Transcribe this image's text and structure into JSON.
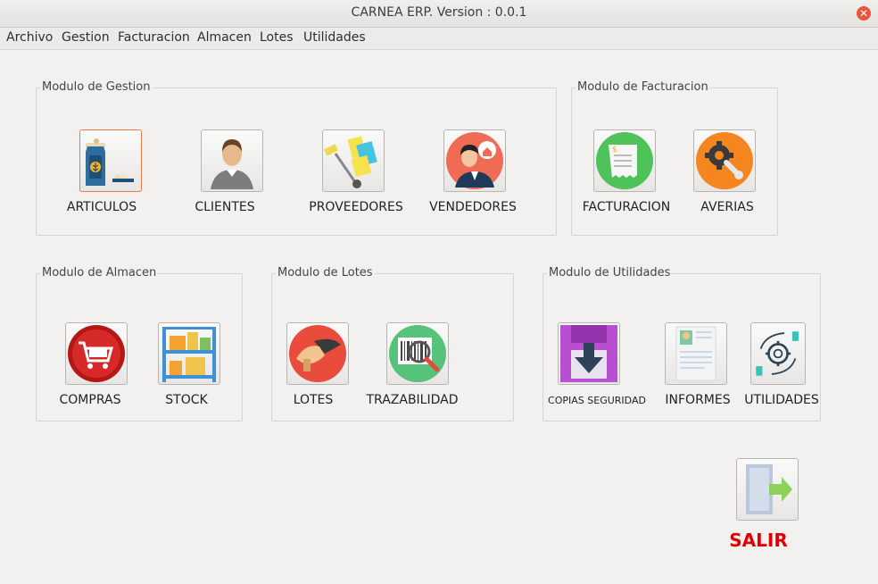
{
  "window": {
    "title": "CARNEA ERP. Version : 0.0.1"
  },
  "menu": [
    "Archivo",
    "Gestion",
    "Facturacion",
    "Almacen",
    "Lotes",
    "Utilidades"
  ],
  "groups": {
    "gestion": "Modulo de Gestion",
    "facturacion": "Modulo de Facturacion",
    "almacen": "Modulo de Almacen",
    "lotes": "Modulo de Lotes",
    "utilidades": "Modulo de Utilidades"
  },
  "buttons": {
    "articulos": "ARTICULOS",
    "clientes": "CLIENTES",
    "proveedores": "PROVEEDORES",
    "vendedores": "VENDEDORES",
    "facturacion": "FACTURACION",
    "averias": "AVERIAS",
    "compras": "COMPRAS",
    "stock": "STOCK",
    "lotes": "LOTES",
    "trazabilidad": "TRAZABILIDAD",
    "copias": "COPIAS SEGURIDAD",
    "informes": "INFORMES",
    "utilidades": "UTILIDADES",
    "salir": "SALIR"
  }
}
